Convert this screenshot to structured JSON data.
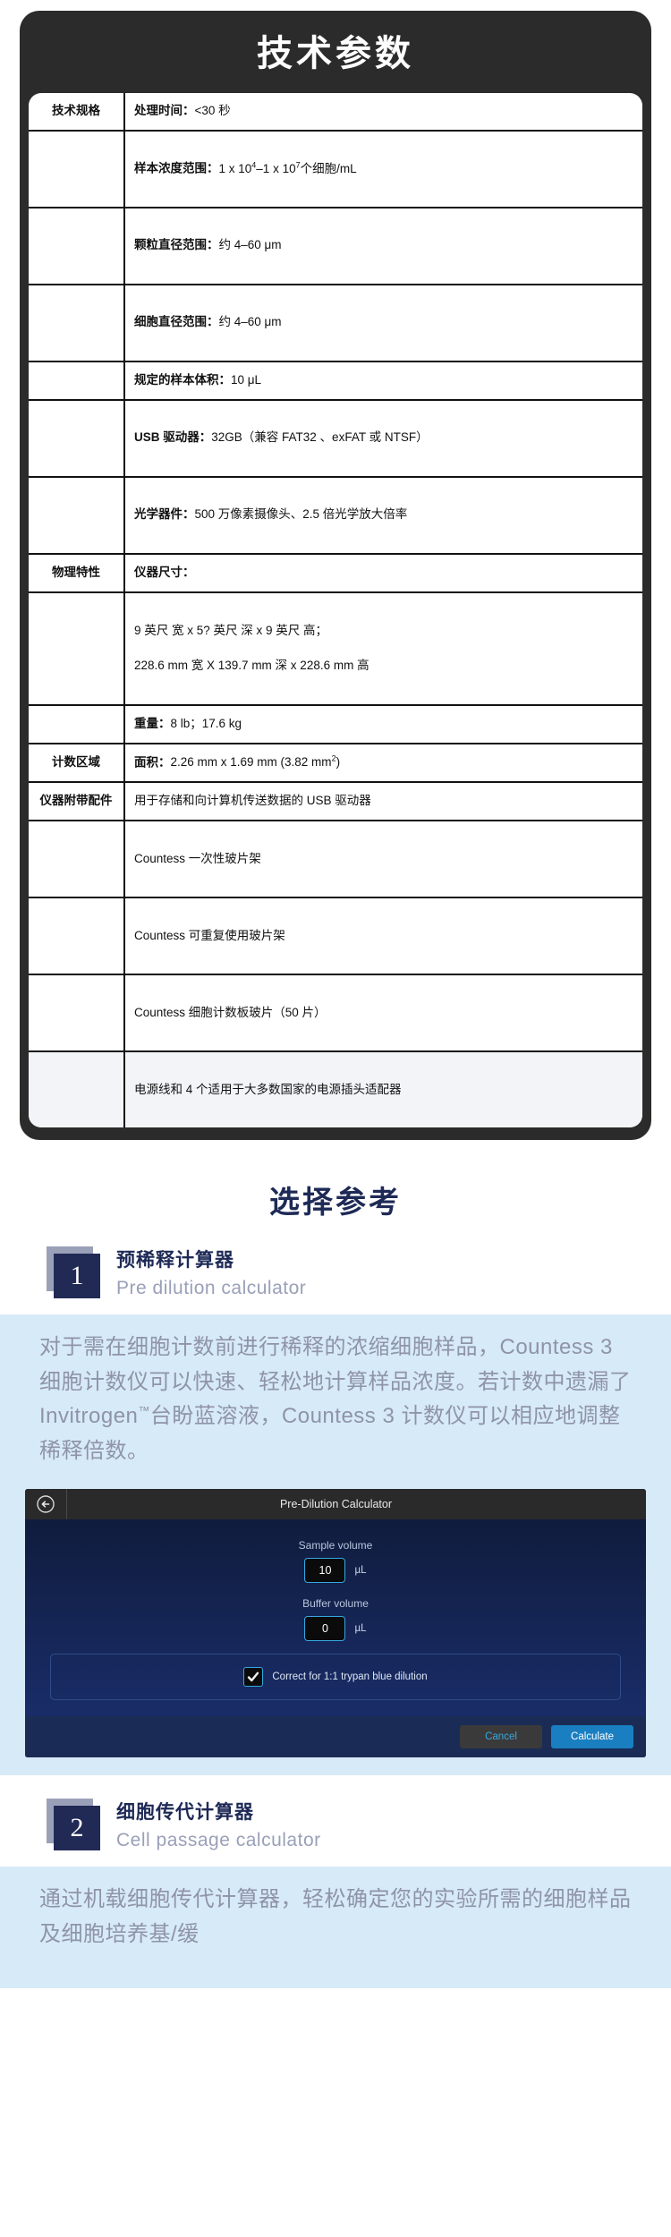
{
  "spec": {
    "title": "技术参数",
    "rows": [
      {
        "k": "技术规格",
        "label": "处理时间：",
        "value": "<30 秒",
        "tall": false
      },
      {
        "k": "",
        "label": "样本浓度范围：",
        "value": "1 x 10⁴–1 x 10⁷个细胞/mL",
        "tall": true
      },
      {
        "k": "",
        "label": "颗粒直径范围：",
        "value": "约 4–60 μm",
        "tall": true
      },
      {
        "k": "",
        "label": "细胞直径范围：",
        "value": "约 4–60 μm",
        "tall": true
      },
      {
        "k": "",
        "label": "规定的样本体积：",
        "value": "10 μL",
        "tall": false
      },
      {
        "k": "",
        "label": "USB 驱动器：",
        "value": "32GB（兼容 FAT32 、exFAT 或 NTSF）",
        "tall": true
      },
      {
        "k": "",
        "label": "光学器件：",
        "value": "500 万像素摄像头、2.5 倍光学放大倍率",
        "tall": true
      },
      {
        "k": "物理特性",
        "label": "仪器尺寸：",
        "value": "",
        "tall": false
      },
      {
        "k": "",
        "label": "",
        "value": "",
        "tall": false,
        "lines": [
          "9 英尺 宽 x 5? 英尺 深 x 9 英尺 高；",
          "228.6 mm 宽 X 139.7 mm 深 x 228.6 mm 高"
        ]
      },
      {
        "k": "",
        "label": "重量：",
        "value": "8 lb；17.6 kg",
        "tall": false
      },
      {
        "k": "计数区域",
        "label": "面积：",
        "value": "2.26 mm x 1.69 mm (3.82 mm2)",
        "tall": false
      },
      {
        "k": "仪器附带配件",
        "label": "",
        "value": "用于存储和向计算机传送数据的 USB 驱动器",
        "tall": false
      },
      {
        "k": "",
        "label": "",
        "value": "Countess 一次性玻片架",
        "tall": true
      },
      {
        "k": "",
        "label": "",
        "value": "Countess 可重复使用玻片架",
        "tall": true
      },
      {
        "k": "",
        "label": "",
        "value": "Countess 细胞计数板玻片（50 片）",
        "tall": true
      },
      {
        "k": "",
        "label": "",
        "value": "电源线和 4 个适用于大多数国家的电源插头适配器",
        "tall": true
      }
    ]
  },
  "section": {
    "title": "选择参考",
    "items": [
      {
        "number": "1",
        "title_cn": "预稀释计算器",
        "title_en": "Pre dilution calculator",
        "paragraph": "对于需在细胞计数前进行稀释的浓缩细胞样品，Countess 3细胞计数仪可以快速、轻松地计算样品浓度。若计数中遗漏了Invitrogen™台盼蓝溶液，Countess 3 计数仪可以相应地调整稀释倍数。"
      },
      {
        "number": "2",
        "title_cn": "细胞传代计算器",
        "title_en": "Cell passage calculator",
        "paragraph": "通过机载细胞传代计算器，轻松确定您的实验所需的细胞样品及细胞培养基/缓"
      }
    ]
  },
  "device": {
    "back_icon": "back-arrow-icon",
    "title": "Pre-Dilution Calculator",
    "fields": [
      {
        "label": "Sample volume",
        "value": "10",
        "unit": "µL"
      },
      {
        "label": "Buffer volume",
        "value": "0",
        "unit": "µL"
      }
    ],
    "checkbox": {
      "checked": true,
      "label": "Correct for 1:1 trypan blue dilution"
    },
    "buttons": {
      "cancel": "Cancel",
      "calculate": "Calculate"
    }
  },
  "colors": {
    "card_bg": "#2b2b2b",
    "navy": "#212a55",
    "muted": "#9aa0b8",
    "band": "#d7eaf7",
    "accent_blue": "#35a8e0"
  }
}
